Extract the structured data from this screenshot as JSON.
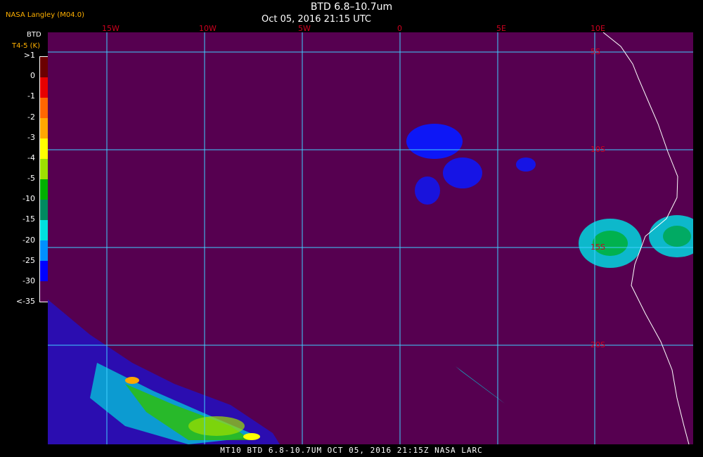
{
  "title": "BTD 6.8–10.7um",
  "subtitle": "Oct 05, 2016 21:15 UTC",
  "source": "NASA Langley (M04.0)",
  "legend": {
    "label_top": "BTD",
    "label_unit": "T4-5 (K)",
    "ticks": [
      ">1",
      "0",
      "-1",
      "-2",
      "-3",
      "-4",
      "-5",
      "-10",
      "-15",
      "-20",
      "-25",
      "-30",
      "<-35"
    ],
    "colors": [
      "#6b0000",
      "#e80000",
      "#ff6600",
      "#ffa800",
      "#ffff00",
      "#9ee000",
      "#00b000",
      "#008a60",
      "#00e0e0",
      "#0090ff",
      "#0000ff",
      "#560050"
    ]
  },
  "grid": {
    "lon_labels": [
      "15W",
      "10W",
      "5W",
      "0",
      "5E",
      "10E"
    ],
    "lat_labels": [
      "5S",
      "10S",
      "15S",
      "20S"
    ],
    "line_color": "#3fd0ff"
  },
  "footer": "MT10  BTD 6.8-10.7UM   OCT 05, 2016 21:15Z   NASA LARC",
  "colors": {
    "background": "#560050",
    "coast": "#ffffff"
  }
}
